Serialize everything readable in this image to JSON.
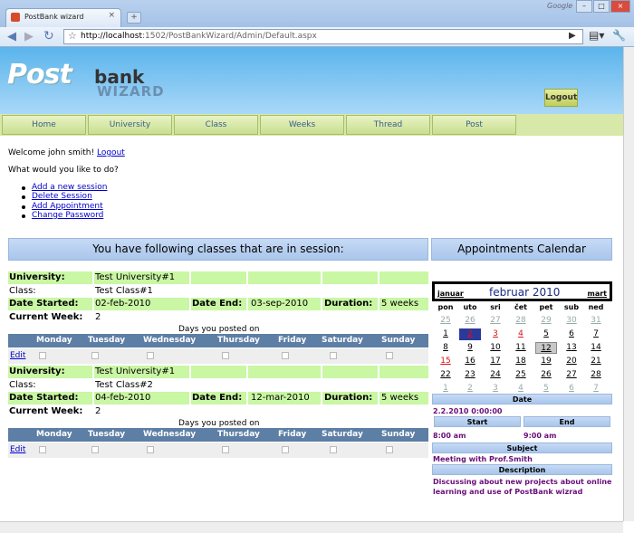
{
  "browser": {
    "tab_title": "PostBank wizard",
    "new_tab": "+",
    "brand": "Google",
    "url_host": "http://localhost",
    "url_rest": ":1502/PostBankWizard/Admin/Default.aspx"
  },
  "header": {
    "logo_post": "Post",
    "logo_bank": "bank",
    "logo_wizard": "WIZARD",
    "logout_button": "Logout"
  },
  "menu": [
    "Home",
    "University",
    "Class",
    "Weeks",
    "Thread",
    "Post"
  ],
  "welcome": {
    "text": "Welcome john smith!",
    "logout_link": "Logout"
  },
  "question": "What would you like to do?",
  "actions": [
    "Add a new session",
    "Delete Session",
    "Add Appointment",
    "Change Password"
  ],
  "classes_heading": "You have following classes that are in session:",
  "calendar_heading": "Appointments Calendar",
  "labels": {
    "university": "University:",
    "class": "Class:",
    "date_started": "Date Started:",
    "date_end": "Date End:",
    "duration": "Duration:",
    "current_week": "Current Week:",
    "posted_on": "Days you posted on",
    "edit": "Edit"
  },
  "days": [
    "Monday",
    "Tuesday",
    "Wednesday",
    "Thursday",
    "Friday",
    "Saturday",
    "Sunday"
  ],
  "sessions": [
    {
      "university": "Test University#1",
      "class": "Test Class#1",
      "date_started": "02-feb-2010",
      "date_end": "03-sep-2010",
      "duration": "5 weeks",
      "current_week": "2"
    },
    {
      "university": "Test University#1",
      "class": "Test Class#2",
      "date_started": "04-feb-2010",
      "date_end": "12-mar-2010",
      "duration": "5 weeks",
      "current_week": "2"
    }
  ],
  "calendar": {
    "prev": "januar",
    "month": "februar 2010",
    "next": "mart",
    "dow": [
      "pon",
      "uto",
      "sri",
      "čet",
      "pet",
      "sub",
      "ned"
    ],
    "weeks": [
      [
        "25",
        "26",
        "27",
        "28",
        "29",
        "30",
        "31"
      ],
      [
        "1",
        "2",
        "3",
        "4",
        "5",
        "6",
        "7"
      ],
      [
        "8",
        "9",
        "10",
        "11",
        "12",
        "13",
        "14"
      ],
      [
        "15",
        "16",
        "17",
        "18",
        "19",
        "20",
        "21"
      ],
      [
        "22",
        "23",
        "24",
        "25",
        "26",
        "27",
        "28"
      ],
      [
        "1",
        "2",
        "3",
        "4",
        "5",
        "6",
        "7"
      ]
    ],
    "selected": "2",
    "today": "12",
    "red_days": [
      "3",
      "4",
      "15"
    ],
    "colors": {
      "selected_bg": "#2a3a9a",
      "today_bg": "#c8c8c8",
      "red": "#e01010",
      "other_month": "#9aa"
    }
  },
  "appointment": {
    "date_label": "Date",
    "date_value": "2.2.2010 0:00:00",
    "start_label": "Start",
    "end_label": "End",
    "start_value": "8:00 am",
    "end_value": "9:00 am",
    "subject_label": "Subject",
    "subject_value": "Meeting with Prof.Smith",
    "description_label": "Description",
    "description_value": "Discussing about new projects about online learning and use of PostBank wizrad"
  }
}
